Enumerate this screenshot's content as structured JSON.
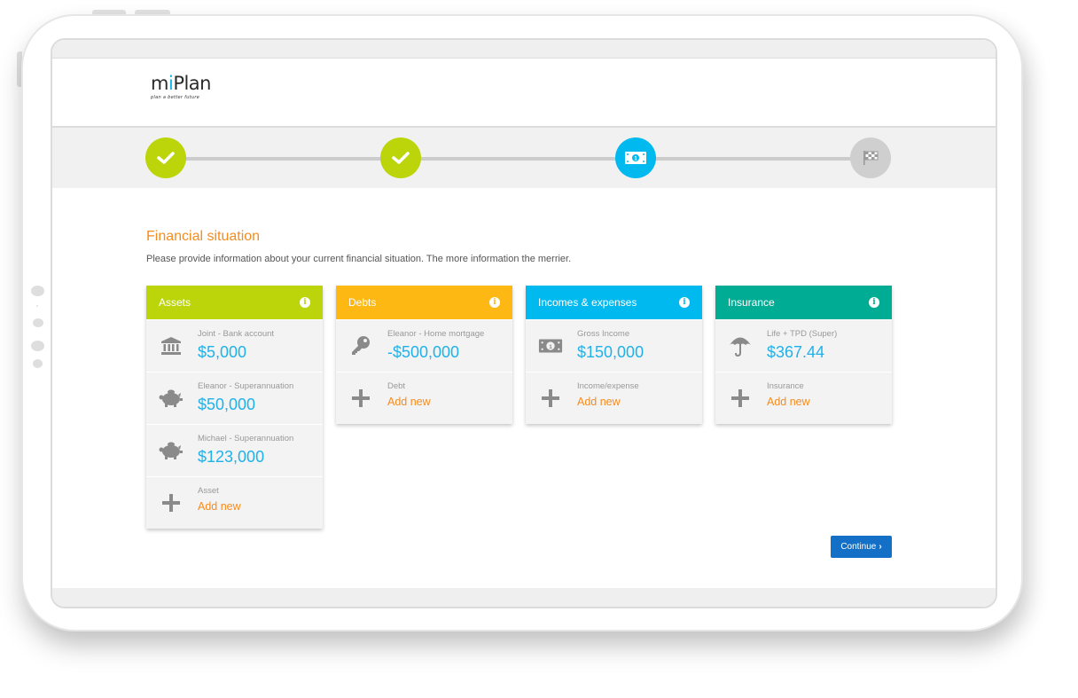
{
  "app": {
    "logo_prefix": "m",
    "logo_accent": "i",
    "logo_suffix": "Plan",
    "tagline": "plan a better future"
  },
  "stepper": {
    "steps": [
      {
        "state": "done",
        "icon": "check-icon"
      },
      {
        "state": "done",
        "icon": "check-icon"
      },
      {
        "state": "current",
        "icon": "money-icon"
      },
      {
        "state": "todo",
        "icon": "flag-icon"
      }
    ]
  },
  "page": {
    "title": "Financial situation",
    "subtitle": "Please provide information about your current financial situation. The more information the merrier."
  },
  "colors": {
    "assets": "#bcd50a",
    "debts": "#fdb813",
    "incomes": "#00b9ef",
    "insurance": "#00ac93",
    "accent_orange": "#f48c1e",
    "value_blue": "#1fb2ea",
    "button_blue": "#1470c6"
  },
  "cards": {
    "assets": {
      "title": "Assets",
      "items": [
        {
          "label": "Joint - Bank account",
          "value": "$5,000",
          "icon": "bank-icon"
        },
        {
          "label": "Eleanor - Superannuation",
          "value": "$50,000",
          "icon": "piggy-bank-icon"
        },
        {
          "label": "Michael - Superannuation",
          "value": "$123,000",
          "icon": "piggy-bank-icon"
        }
      ],
      "add_label": "Asset",
      "add_text": "Add new"
    },
    "debts": {
      "title": "Debts",
      "items": [
        {
          "label": "Eleanor - Home mortgage",
          "value": "-$500,000",
          "icon": "key-icon"
        }
      ],
      "add_label": "Debt",
      "add_text": "Add new"
    },
    "incomes": {
      "title": "Incomes & expenses",
      "items": [
        {
          "label": "Gross Income",
          "value": "$150,000",
          "icon": "money-icon"
        }
      ],
      "add_label": "Income/expense",
      "add_text": "Add new"
    },
    "insurance": {
      "title": "Insurance",
      "items": [
        {
          "label": "Life + TPD (Super)",
          "value": "$367.44",
          "icon": "umbrella-icon"
        }
      ],
      "add_label": "Insurance",
      "add_text": "Add new"
    }
  },
  "actions": {
    "continue_label": "Continue",
    "continue_icon": "›"
  }
}
